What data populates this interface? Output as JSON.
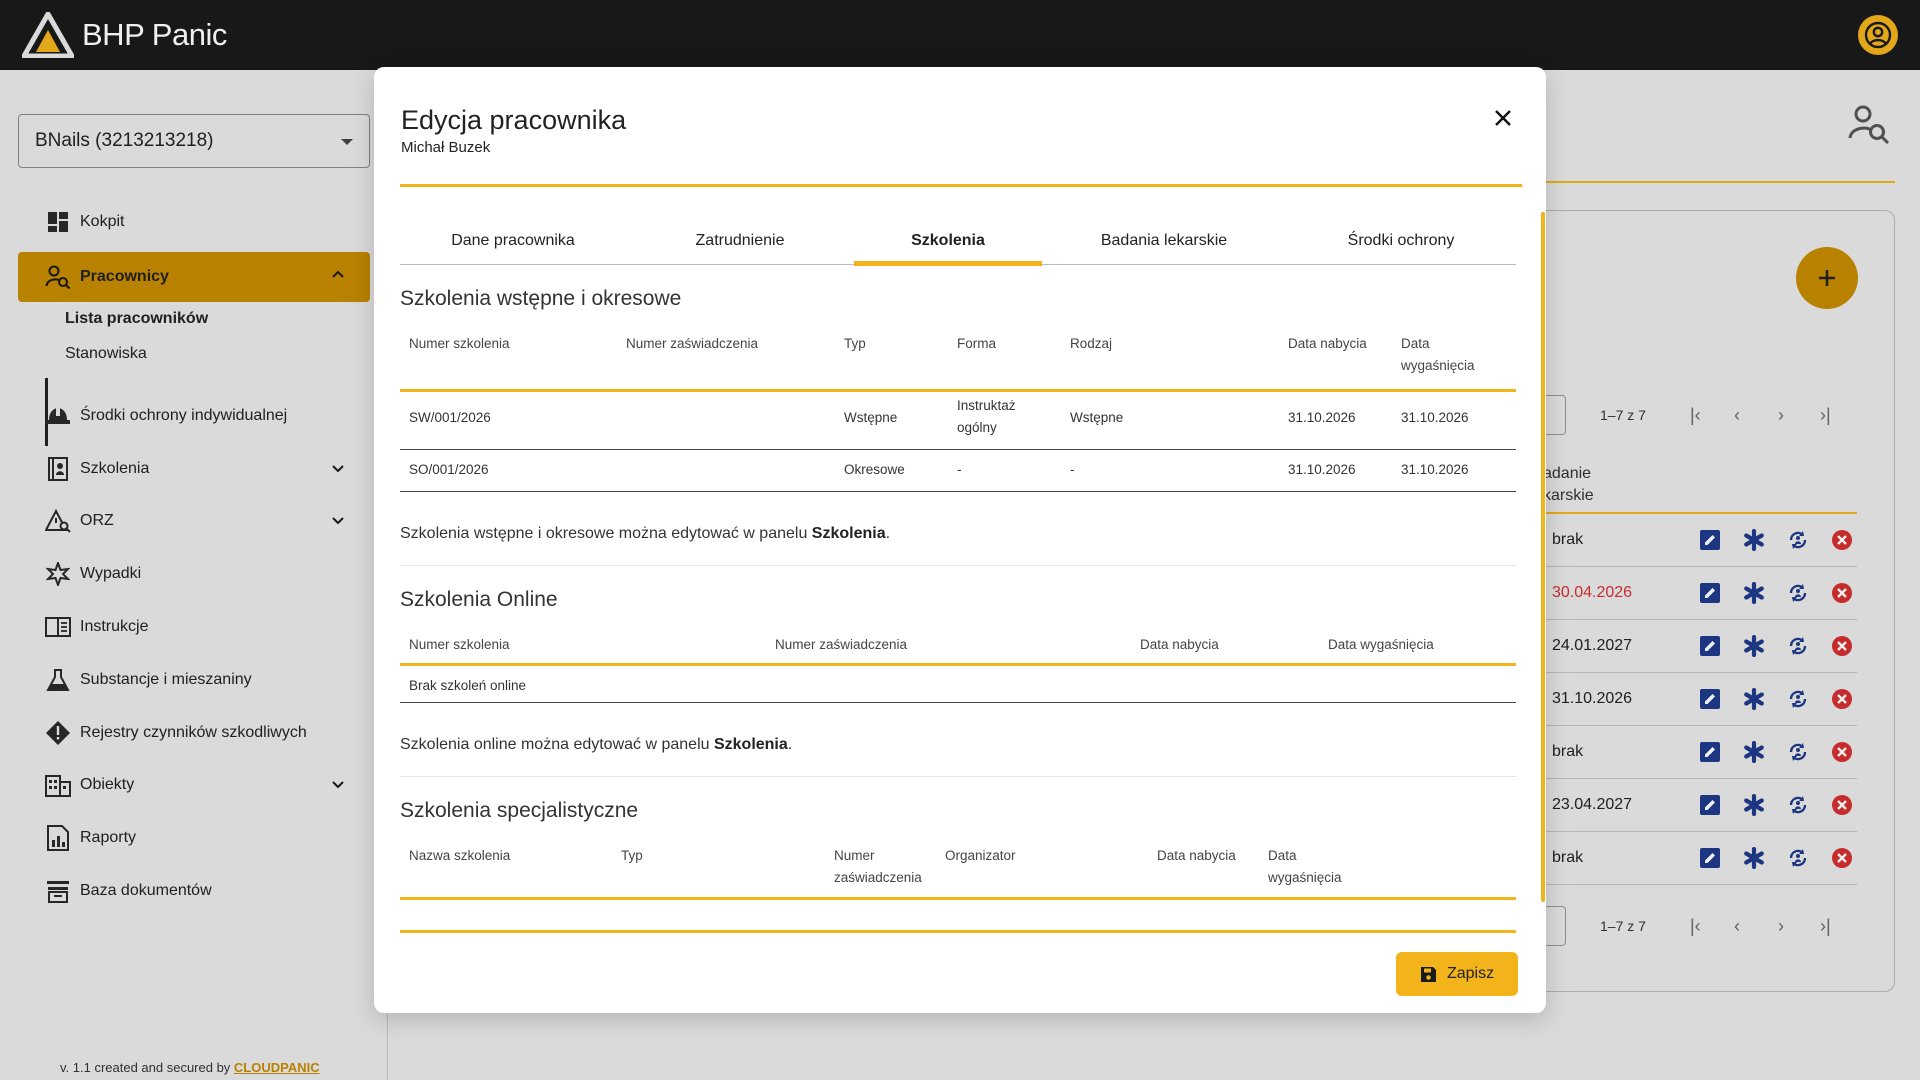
{
  "app": {
    "name": "BHP Panic"
  },
  "company_select": {
    "value": "BNails (3213213218)"
  },
  "sidebar": {
    "items": [
      {
        "label": "Kokpit"
      },
      {
        "label": "Pracownicy"
      },
      {
        "label": "Środki ochrony indywidualnej"
      },
      {
        "label": "Szkolenia"
      },
      {
        "label": "ORZ"
      },
      {
        "label": "Wypadki"
      },
      {
        "label": "Instrukcje"
      },
      {
        "label": "Substancje i mieszaniny"
      },
      {
        "label": "Rejestry czynników szkodliwych"
      },
      {
        "label": "Obiekty"
      },
      {
        "label": "Raporty"
      },
      {
        "label": "Baza dokumentów"
      }
    ],
    "subitems": [
      {
        "label": "Lista pracowników"
      },
      {
        "label": "Stanowiska"
      }
    ]
  },
  "footer": {
    "text": "v. 1.1 created and secured by ",
    "brand": "CLOUDPANIC"
  },
  "background_table": {
    "pager_label": "1–7 z 7",
    "column_header": "adanie\nkarskie",
    "rows": [
      {
        "value": "brak",
        "status": "normal"
      },
      {
        "value": "30.04.2026",
        "status": "expired"
      },
      {
        "value": "24.01.2027",
        "status": "normal"
      },
      {
        "value": "31.10.2026",
        "status": "normal"
      },
      {
        "value": "brak",
        "status": "normal"
      },
      {
        "value": "23.04.2027",
        "status": "normal"
      },
      {
        "value": "brak",
        "status": "normal"
      }
    ]
  },
  "modal": {
    "title": "Edycja pracownika",
    "subtitle": "Michał Buzek",
    "tabs": [
      {
        "label": "Dane pracownika"
      },
      {
        "label": "Zatrudnienie"
      },
      {
        "label": "Szkolenia"
      },
      {
        "label": "Badania lekarskie"
      },
      {
        "label": "Środki ochrony"
      }
    ],
    "active_tab": "Szkolenia",
    "section1": {
      "title": "Szkolenia wstępne i okresowe",
      "headers": [
        "Numer szkolenia",
        "Numer zaświadczenia",
        "Typ",
        "Forma",
        "Rodzaj",
        "Data nabycia",
        "Data wygaśnięcia"
      ],
      "rows": [
        [
          "SW/001/2026",
          "",
          "Wstępne",
          "Instruktaż ogólny",
          "Wstępne",
          "31.10.2026",
          "31.10.2026"
        ],
        [
          "SO/001/2026",
          "",
          "Okresowe",
          "-",
          "-",
          "31.10.2026",
          "31.10.2026"
        ]
      ],
      "note_prefix": "Szkolenia wstępne i okresowe można edytować w panelu ",
      "note_bold": "Szkolenia",
      "note_suffix": "."
    },
    "section2": {
      "title": "Szkolenia Online",
      "headers": [
        "Numer szkolenia",
        "Numer zaświadczenia",
        "Data nabycia",
        "Data wygaśnięcia"
      ],
      "empty": "Brak szkoleń online",
      "note_prefix": "Szkolenia online można edytować w panelu ",
      "note_bold": "Szkolenia",
      "note_suffix": "."
    },
    "section3": {
      "title": "Szkolenia specjalistyczne",
      "headers": [
        "Nazwa szkolenia",
        "Typ",
        "Numer zaświadczenia",
        "Organizator",
        "Data nabycia",
        "Data wygaśnięcia"
      ]
    },
    "save_label": "Zapisz"
  },
  "colors": {
    "accent": "#f2b31b",
    "accent_dark": "#c48a00",
    "danger": "#d32f2f",
    "action_blue": "#1e3a8a"
  }
}
